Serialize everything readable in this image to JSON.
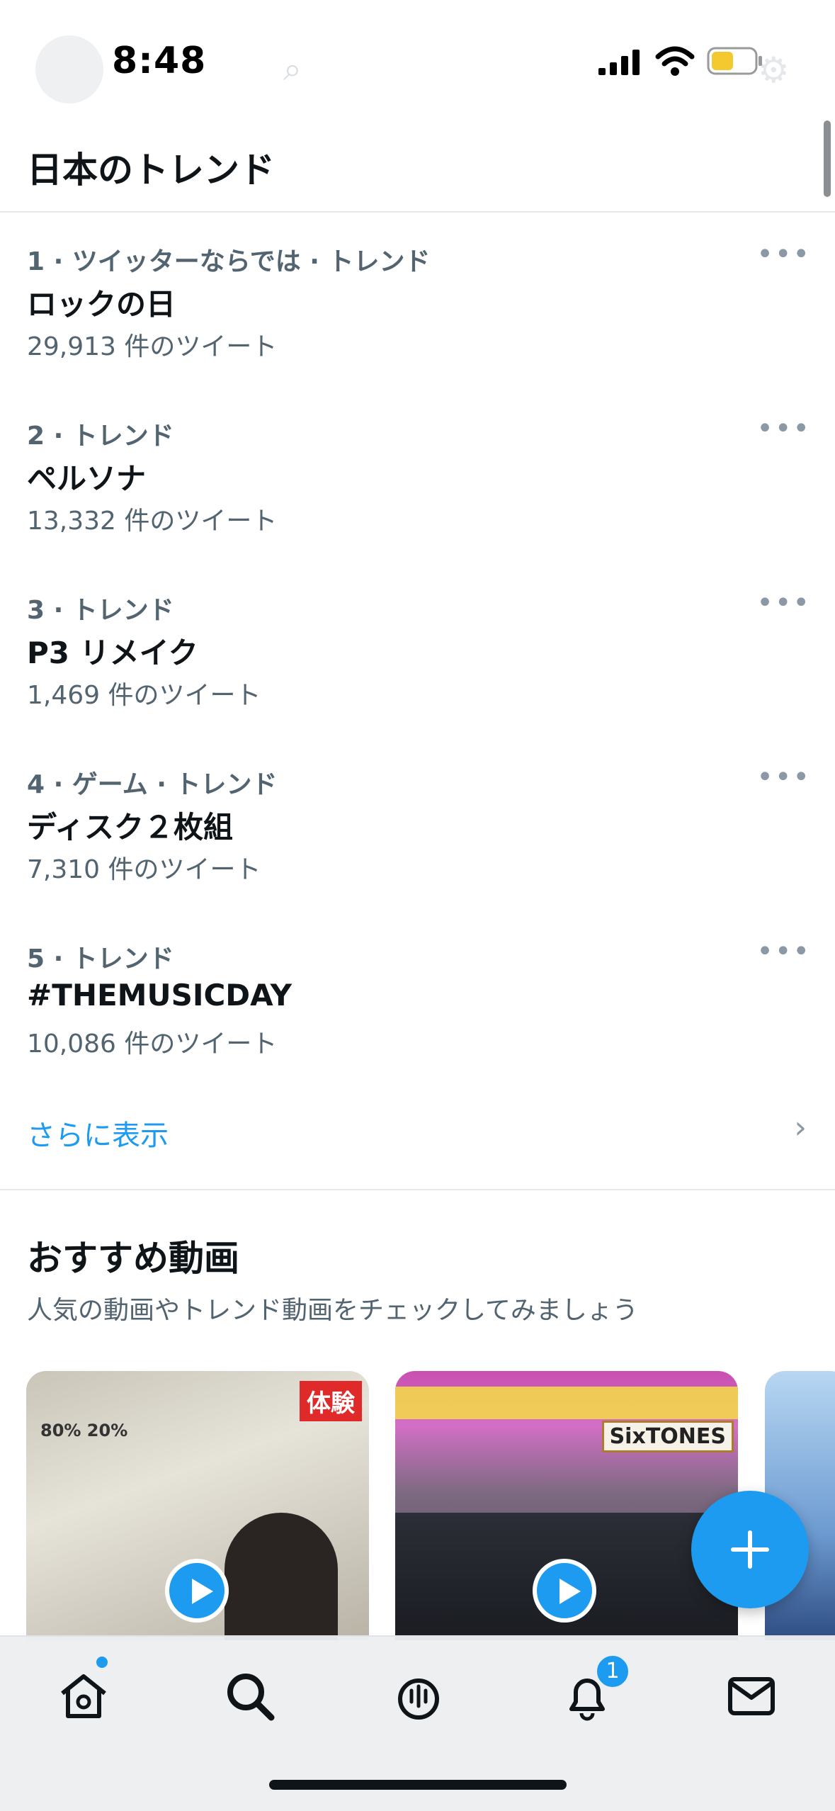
{
  "status_bar": {
    "time": "8:48"
  },
  "header": {
    "title": "日本のトレンド"
  },
  "trends": [
    {
      "meta": "1 · ツイッターならでは · トレンド",
      "name": "ロックの日",
      "count": "29,913 件のツイート"
    },
    {
      "meta": "2 · トレンド",
      "name": "ペルソナ",
      "count": "13,332 件のツイート"
    },
    {
      "meta": "3 · トレンド",
      "name": "P3 リメイク",
      "count": "1,469 件のツイート"
    },
    {
      "meta": "4 · ゲーム · トレンド",
      "name": "ディスク２枚組",
      "count": "7,310 件のツイート"
    },
    {
      "meta": "5 · トレンド",
      "name": "#THEMUSICDAY",
      "count": "10,086 件のツイート"
    }
  ],
  "more_icon": "•••",
  "show_more": {
    "label": "さらに表示",
    "chevron": "›"
  },
  "recommended": {
    "title": "おすすめ動画",
    "subtitle": "人気の動画やトレンド動画をチェックしてみましょう",
    "videos": [
      {
        "overlay": "体験",
        "weather": "80%   20%"
      },
      {
        "overlay": "SixTONES"
      }
    ]
  },
  "tab_bar": {
    "items": [
      "home-icon",
      "search-icon",
      "spaces-icon",
      "bell-icon",
      "mail-icon"
    ],
    "notification_count": "1"
  },
  "colors": {
    "accent": "#1d9bf0",
    "text_primary": "#0f1419",
    "text_secondary": "#536471"
  }
}
